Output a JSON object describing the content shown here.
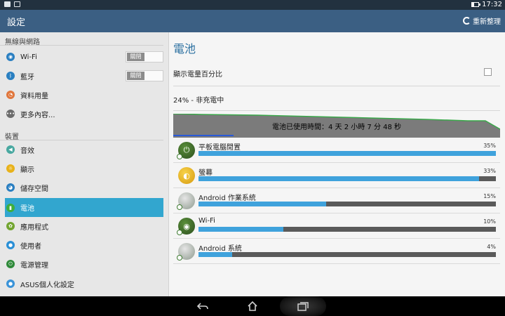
{
  "status_bar": {
    "time": "17:32"
  },
  "action_bar": {
    "title": "設定",
    "refresh_label": "重新整理"
  },
  "sidebar": {
    "sections": [
      {
        "header": "無線與網路"
      },
      {
        "header": "裝置"
      }
    ],
    "items": [
      {
        "label": "Wi-Fi",
        "icon": "wifi-icon",
        "color": "#2a7fc1",
        "toggle": "關閉"
      },
      {
        "label": "藍牙",
        "icon": "bluetooth-icon",
        "color": "#2a7fc1",
        "toggle": "關閉"
      },
      {
        "label": "資料用量",
        "icon": "data-usage-icon",
        "color": "#e0763c"
      },
      {
        "label": "更多內容...",
        "icon": "more-icon",
        "color": "#6c6c6c"
      },
      {
        "label": "音效",
        "icon": "sound-icon",
        "color": "#48a8a0"
      },
      {
        "label": "顯示",
        "icon": "display-icon",
        "color": "#e8b21a"
      },
      {
        "label": "儲存空間",
        "icon": "storage-icon",
        "color": "#2a7fc1"
      },
      {
        "label": "電池",
        "icon": "battery-icon",
        "color": "#3fae3b"
      },
      {
        "label": "應用程式",
        "icon": "apps-icon",
        "color": "#72a530"
      },
      {
        "label": "使用者",
        "icon": "user-icon",
        "color": "#2a8fd6"
      },
      {
        "label": "電源管理",
        "icon": "power-management-icon",
        "color": "#2f8a3a"
      },
      {
        "label": "ASUS個人化設定",
        "icon": "asus-settings-icon",
        "color": "#3a93d8"
      }
    ],
    "selected": "電池"
  },
  "main": {
    "title": "電池",
    "show_percent_label": "顯示電量百分比",
    "show_percent_checked": false,
    "status": "24% - 非充電中",
    "graph_caption": "電池已使用時間：4 天 2 小時 7 分 48 秒",
    "usage": [
      {
        "name": "平板電腦閒置",
        "percent": "35%",
        "value": 35,
        "icon": "power-icon"
      },
      {
        "name": "螢幕",
        "percent": "33%",
        "value": 33,
        "icon": "brightness-icon"
      },
      {
        "name": "Android 作業系統",
        "percent": "15%",
        "value": 15,
        "icon": "android-os-icon"
      },
      {
        "name": "Wi-Fi",
        "percent": "10%",
        "value": 10,
        "icon": "wifi-usage-icon"
      },
      {
        "name": "Android 系統",
        "percent": "4%",
        "value": 4,
        "icon": "android-system-icon"
      }
    ]
  },
  "colors": {
    "accent": "#32a6cf",
    "actionbar": "#3b5f83",
    "bar_fill": "#3fa2dc",
    "graph_line": "#3aa84a"
  },
  "navbar": {
    "buttons": [
      "back-icon",
      "home-icon",
      "recent-apps-icon"
    ]
  }
}
